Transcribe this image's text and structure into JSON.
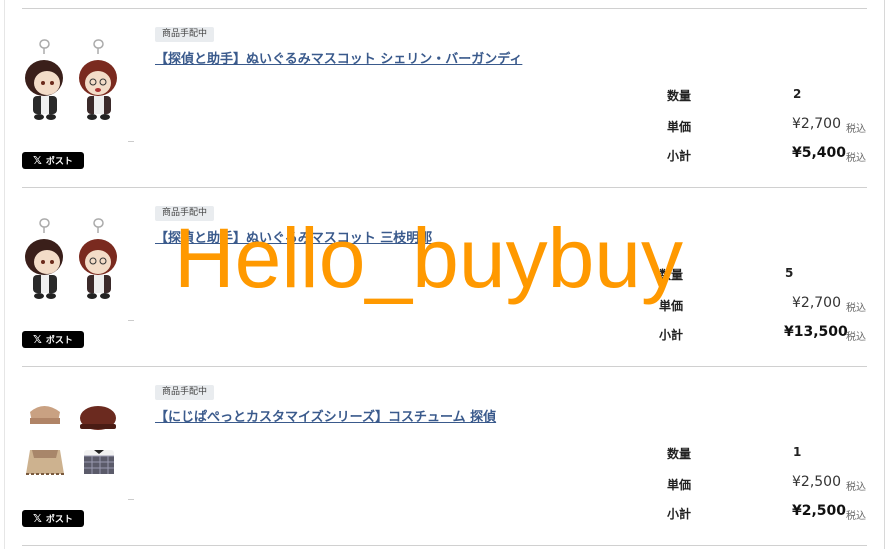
{
  "items": [
    {
      "status": "商品手配中",
      "title": "【探偵と助手】ぬいぐるみマスコット シェリン・バーガンディ",
      "share": "ポスト",
      "qty_label": "数量",
      "qty": "2",
      "unit_label": "単価",
      "unit_price": "¥2,700",
      "unit_tax": "税込",
      "subtotal_label": "小計",
      "subtotal": "¥5,400",
      "subtotal_tax": "税込"
    },
    {
      "status": "商品手配中",
      "title": "【探偵と助手】ぬいぐるみマスコット 三枝明那",
      "share": "ポスト",
      "qty_label": "数量",
      "qty": "5",
      "unit_label": "単価",
      "unit_price": "¥2,700",
      "unit_tax": "税込",
      "subtotal_label": "小計",
      "subtotal": "¥13,500",
      "subtotal_tax": "税込"
    },
    {
      "status": "商品手配中",
      "title": "【にじぱぺっとカスタマイズシリーズ】コスチューム 探偵",
      "share": "ポスト",
      "qty_label": "数量",
      "qty": "1",
      "unit_label": "単価",
      "unit_price": "¥2,500",
      "unit_tax": "税込",
      "subtotal_label": "小計",
      "subtotal": "¥2,500",
      "subtotal_tax": "税込"
    }
  ],
  "x_icon": "x-logo-icon",
  "watermark": "Hello_buybuy",
  "colors": {
    "link": "#3a5a8c",
    "watermark": "#ff9900",
    "badge_bg": "#e9ecef"
  }
}
